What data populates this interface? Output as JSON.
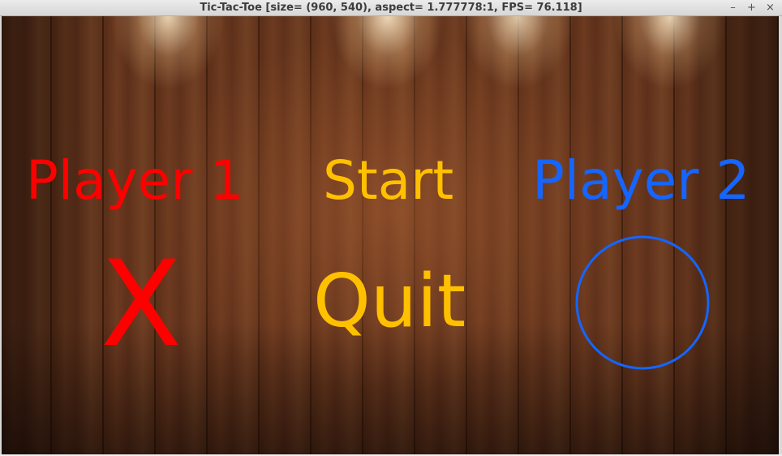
{
  "window": {
    "title": "Tic-Tac-Toe [size= (960, 540), aspect= 1.777778:1, FPS= 76.118]",
    "controls": {
      "minimize": "–",
      "maximize": "+",
      "close": "×"
    }
  },
  "menu": {
    "player1_label": "Player 1",
    "start_label": "Start",
    "player2_label": "Player 2",
    "quit_label": "Quit",
    "player1_symbol": "X",
    "player2_symbol": "circle"
  },
  "colors": {
    "player1": "#ff0000",
    "player2": "#1565ff",
    "menu_option": "#ffc000"
  }
}
